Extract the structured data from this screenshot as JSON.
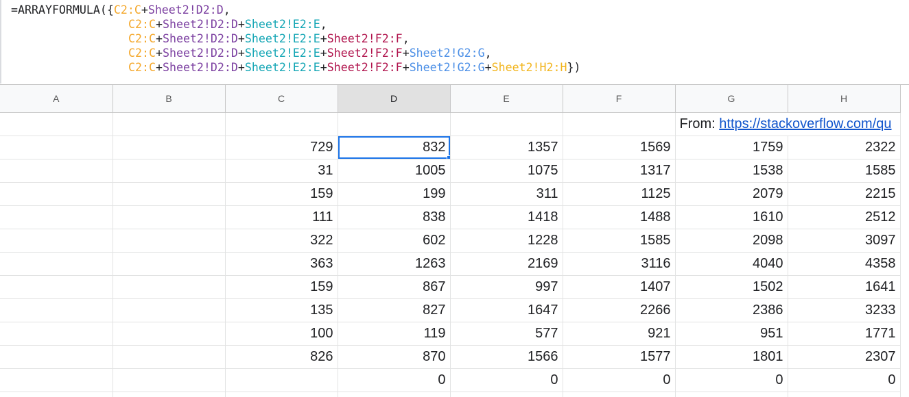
{
  "formula": {
    "lines": [
      [
        {
          "t": "=ARRAYFORMULA({",
          "c": "#202124"
        },
        {
          "t": "C2:C",
          "c": "#f4a82c"
        },
        {
          "t": "+",
          "c": "#202124"
        },
        {
          "t": "Sheet2!D2:D",
          "c": "#7b3fa0"
        },
        {
          "t": ",",
          "c": "#202124"
        }
      ],
      [
        {
          "t": "C2:C",
          "c": "#f4a82c"
        },
        {
          "t": "+",
          "c": "#202124"
        },
        {
          "t": "Sheet2!D2:D",
          "c": "#7b3fa0"
        },
        {
          "t": "+",
          "c": "#202124"
        },
        {
          "t": "Sheet2!E2:E",
          "c": "#12a5b4"
        },
        {
          "t": ",",
          "c": "#202124"
        }
      ],
      [
        {
          "t": "C2:C",
          "c": "#f4a82c"
        },
        {
          "t": "+",
          "c": "#202124"
        },
        {
          "t": "Sheet2!D2:D",
          "c": "#7b3fa0"
        },
        {
          "t": "+",
          "c": "#202124"
        },
        {
          "t": "Sheet2!E2:E",
          "c": "#12a5b4"
        },
        {
          "t": "+",
          "c": "#202124"
        },
        {
          "t": "Sheet2!F2:F",
          "c": "#b0134c"
        },
        {
          "t": ",",
          "c": "#202124"
        }
      ],
      [
        {
          "t": "C2:C",
          "c": "#f4a82c"
        },
        {
          "t": "+",
          "c": "#202124"
        },
        {
          "t": "Sheet2!D2:D",
          "c": "#7b3fa0"
        },
        {
          "t": "+",
          "c": "#202124"
        },
        {
          "t": "Sheet2!E2:E",
          "c": "#12a5b4"
        },
        {
          "t": "+",
          "c": "#202124"
        },
        {
          "t": "Sheet2!F2:F",
          "c": "#b0134c"
        },
        {
          "t": "+",
          "c": "#202124"
        },
        {
          "t": "Sheet2!G2:G",
          "c": "#4a8ee6"
        },
        {
          "t": ",",
          "c": "#202124"
        }
      ],
      [
        {
          "t": "C2:C",
          "c": "#f4a82c"
        },
        {
          "t": "+",
          "c": "#202124"
        },
        {
          "t": "Sheet2!D2:D",
          "c": "#7b3fa0"
        },
        {
          "t": "+",
          "c": "#202124"
        },
        {
          "t": "Sheet2!E2:E",
          "c": "#12a5b4"
        },
        {
          "t": "+",
          "c": "#202124"
        },
        {
          "t": "Sheet2!F2:F",
          "c": "#b0134c"
        },
        {
          "t": "+",
          "c": "#202124"
        },
        {
          "t": "Sheet2!G2:G",
          "c": "#4a8ee6"
        },
        {
          "t": "+",
          "c": "#202124"
        },
        {
          "t": "Sheet2!H2:H",
          "c": "#f2b51d"
        },
        {
          "t": "})",
          "c": "#202124"
        }
      ]
    ]
  },
  "grid": {
    "columns": [
      "A",
      "B",
      "C",
      "D",
      "E",
      "F",
      "G",
      "H"
    ],
    "selected_column": "D",
    "active_cell": "D2",
    "header_row": {
      "source_label": "From: ",
      "source_link": "https://stackoverflow.com/qu"
    },
    "rows": [
      [
        "",
        "",
        "729",
        "832",
        "1357",
        "1569",
        "1759",
        "2322"
      ],
      [
        "",
        "",
        "31",
        "1005",
        "1075",
        "1317",
        "1538",
        "1585"
      ],
      [
        "",
        "",
        "159",
        "199",
        "311",
        "1125",
        "2079",
        "2215"
      ],
      [
        "",
        "",
        "111",
        "838",
        "1418",
        "1488",
        "1610",
        "2512"
      ],
      [
        "",
        "",
        "322",
        "602",
        "1228",
        "1585",
        "2098",
        "3097"
      ],
      [
        "",
        "",
        "363",
        "1263",
        "2169",
        "3116",
        "4040",
        "4358"
      ],
      [
        "",
        "",
        "159",
        "867",
        "997",
        "1407",
        "1502",
        "1641"
      ],
      [
        "",
        "",
        "135",
        "827",
        "1647",
        "2266",
        "2386",
        "3233"
      ],
      [
        "",
        "",
        "100",
        "119",
        "577",
        "921",
        "951",
        "1771"
      ],
      [
        "",
        "",
        "826",
        "870",
        "1566",
        "1577",
        "1801",
        "2307"
      ],
      [
        "",
        "",
        "",
        "0",
        "0",
        "0",
        "0",
        "0"
      ],
      [
        "",
        "",
        "",
        "",
        "",
        "",
        "",
        ""
      ]
    ]
  },
  "colors": {
    "active_border": "#1a73e8",
    "header_bg": "#f8f9fa",
    "selected_header_bg": "#e1e1e1",
    "link": "#1155cc"
  }
}
